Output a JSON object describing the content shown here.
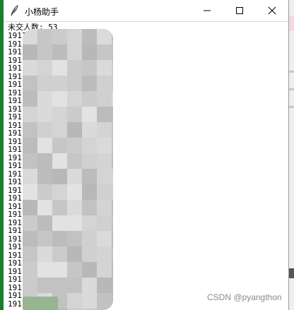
{
  "window": {
    "title": "小杨助手",
    "controls": {
      "minimize": "minimize",
      "maximize": "maximize",
      "close": "close"
    }
  },
  "content": {
    "summary": "未交人数: 53",
    "lines": [
      "19110",
      "1911",
      "19110",
      "1911",
      "191",
      "191",
      "191",
      "191",
      "191",
      "191",
      "191",
      "191",
      "191",
      "19116",
      "19116",
      "19116",
      "19116",
      "19116",
      "19116",
      "19116",
      "19116",
      "19116",
      "19116",
      "19116",
      "19116",
      "1911",
      "1911",
      "1911",
      "191",
      "191",
      "191",
      "191",
      "191",
      "191"
    ]
  },
  "desktop": {
    "watermark": "CSDN @pyangthon"
  },
  "colors": {
    "desktop_left": "#1f7a2e",
    "redaction": "#cfcfcf"
  }
}
